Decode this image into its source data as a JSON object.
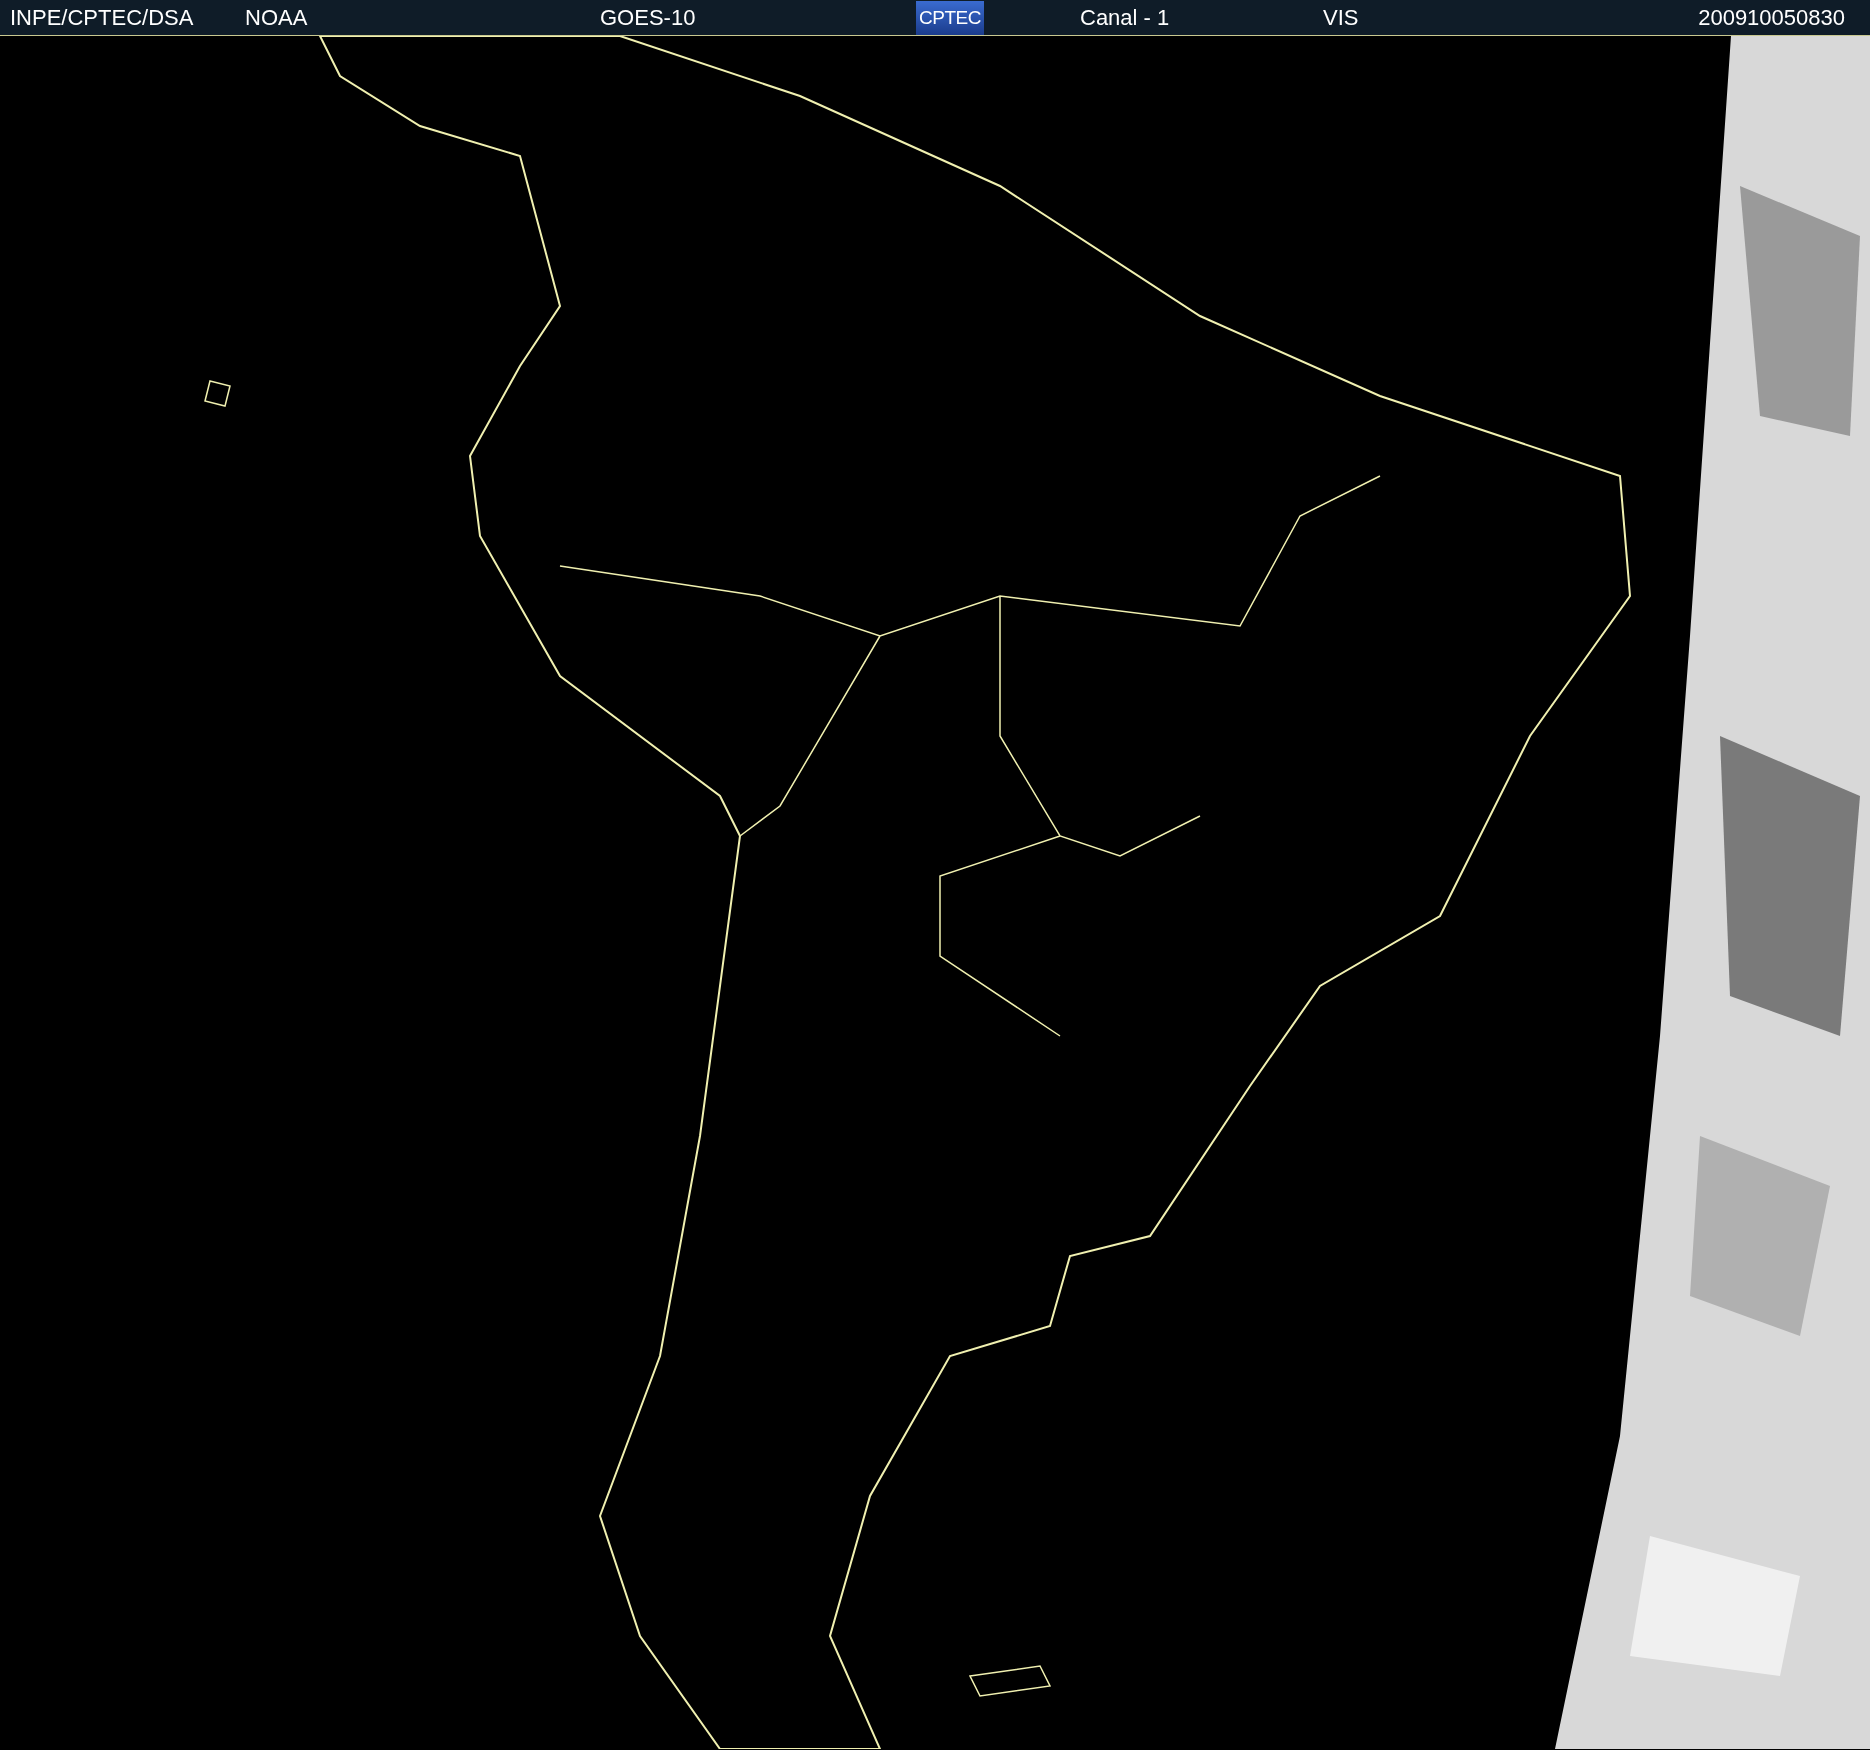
{
  "header": {
    "source": "INPE/CPTEC/DSA",
    "agency": "NOAA",
    "satellite": "GOES-10",
    "logo": "CPTEC",
    "channel": "Canal - 1",
    "band": "VIS",
    "timestamp": "200910050830"
  }
}
